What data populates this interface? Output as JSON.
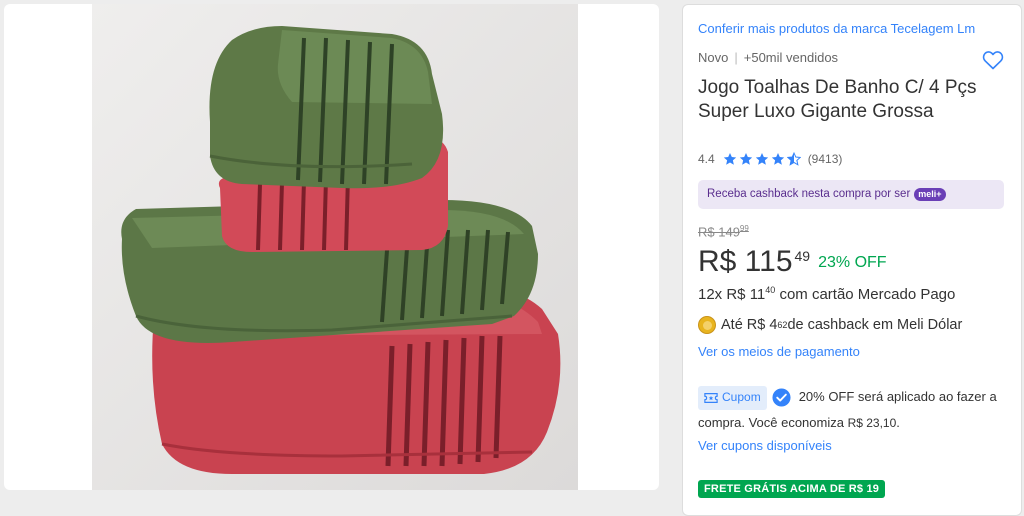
{
  "product": {
    "brand_link": "Conferir mais produtos da marca Tecelagem Lm",
    "condition": "Novo",
    "sold": "+50mil vendidos",
    "title": "Jogo Toalhas De Banho C/ 4 Pçs Super Luxo Gigante Grossa",
    "rating": "4.4",
    "rating_stars": 4.5,
    "review_count": "(9413)"
  },
  "cashback_banner": {
    "text": "Receba cashback nesta compra por ser",
    "badge": "meli+"
  },
  "pricing": {
    "old_price": "R$ 149",
    "old_cents": "99",
    "price": "R$ 115",
    "price_cents": "49",
    "discount": "23% OFF",
    "installments_prefix": "12x R$ 11",
    "installments_cents": "40",
    "installments_suffix": " com cartão Mercado Pago",
    "meli_dolar_prefix": "Até R$ 4",
    "meli_dolar_cents": "62",
    "meli_dolar_suffix": " de cashback em Meli Dólar",
    "payment_link": "Ver os meios de pagamento"
  },
  "coupon": {
    "chip_label": "Cupom",
    "text_a": "20% OFF será aplicado ao fazer a compra. Você economiza ",
    "savings": "R$ 23,10",
    "text_b": ".",
    "link": "Ver cupons disponíveis"
  },
  "shipping": {
    "badge": "FRETE GRÁTIS ACIMA DE R$ 19"
  },
  "colors": {
    "link": "#3483fa",
    "discount": "#00a650",
    "star": "#3483fa",
    "towel_green": "#5f7a49",
    "towel_red": "#cf4a55"
  },
  "icons": [
    "heart-icon",
    "star-icon",
    "meli-dolar-coin-icon",
    "coupon-icon",
    "check-icon"
  ]
}
